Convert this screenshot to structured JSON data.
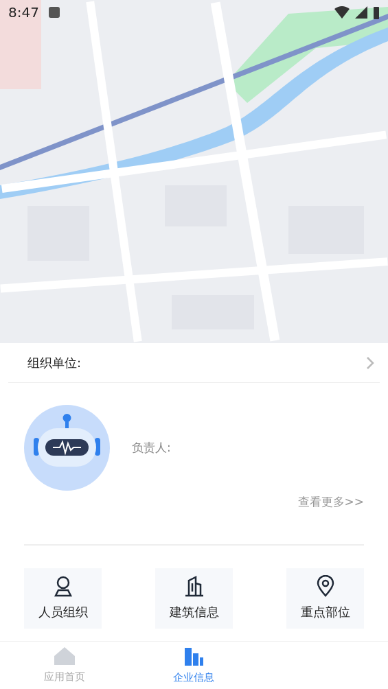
{
  "status_bar": {
    "time": "8:47"
  },
  "org_row": {
    "label": "组织单位:"
  },
  "profile": {
    "label": "负责人:",
    "more_link": "查看更多>>"
  },
  "shortcuts": [
    {
      "kind": "person",
      "label": "人员组织"
    },
    {
      "kind": "building",
      "label": "建筑信息"
    },
    {
      "kind": "pin",
      "label": "重点部位"
    }
  ],
  "bottom_nav": [
    {
      "kind": "home",
      "label": "应用首页",
      "selected": false
    },
    {
      "kind": "company",
      "label": "企业信息",
      "selected": true
    }
  ]
}
